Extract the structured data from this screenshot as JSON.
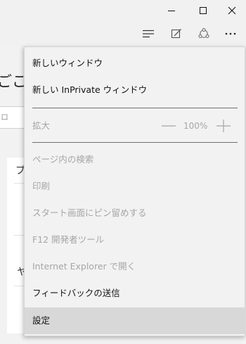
{
  "titlebar": {
    "buttons": [
      {
        "name": "minimize",
        "icon": "minimize-icon"
      },
      {
        "name": "maximize",
        "icon": "maximize-icon"
      },
      {
        "name": "close",
        "icon": "close-icon"
      }
    ]
  },
  "toolbar": {
    "icons": [
      "hub-icon",
      "web-note-icon",
      "share-icon",
      "more-actions-icon"
    ]
  },
  "page": {
    "heading": "ごこへ",
    "search_text": "ロ",
    "card_chars": [
      "ブ",
      "ヤ"
    ]
  },
  "menu": {
    "new_window": "新しいウィンドウ",
    "new_inprivate_window": "新しい InPrivate ウィンドウ",
    "zoom": {
      "label": "拡大",
      "value": "100%",
      "minus_icon": "minus-icon",
      "plus_icon": "plus-icon"
    },
    "find_on_page": "ページ内の検索",
    "print": "印刷",
    "pin_to_start": "スタート画面にピン留めする",
    "f12_dev_tools": "F12 開発者ツール",
    "open_with_ie": "Internet Explorer で開く",
    "send_feedback": "フィードバックの送信",
    "settings": "設定"
  },
  "colors": {
    "menu_background": "#f2f2f2",
    "selected_background": "#d8d8d8",
    "disabled_text": "#a6a6a6"
  }
}
